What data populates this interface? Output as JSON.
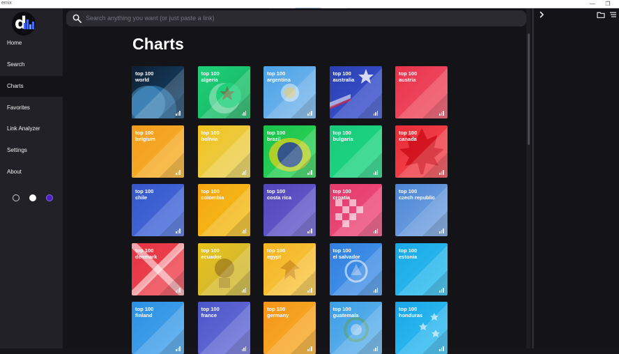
{
  "window": {
    "app_name": "emix",
    "controls": [
      "—",
      "❐"
    ]
  },
  "sidebar": {
    "items": [
      {
        "label": "Home",
        "active": false
      },
      {
        "label": "Search",
        "active": false
      },
      {
        "label": "Charts",
        "active": true
      },
      {
        "label": "Favorites",
        "active": false
      },
      {
        "label": "Link Analyzer",
        "active": false
      },
      {
        "label": "Settings",
        "active": false
      },
      {
        "label": "About",
        "active": false
      }
    ],
    "themes": [
      "dark",
      "light",
      "purple"
    ]
  },
  "search": {
    "placeholder": "Search anything you want (or just paste a link)"
  },
  "main": {
    "title": "Charts"
  },
  "charts": [
    {
      "t1": "top 100",
      "t2": "world",
      "color": "#0d1f33",
      "color2": "#184a73",
      "emblem": "globe"
    },
    {
      "t1": "top 100",
      "t2": "algeria",
      "color": "#1fd07a",
      "color2": "#16b35f",
      "emblem": "crescent"
    },
    {
      "t1": "top 100",
      "t2": "argentina",
      "color": "#4aa2e8",
      "color2": "#7db9ea",
      "emblem": "sun"
    },
    {
      "t1": "top 100",
      "t2": "australia",
      "color": "#2a3fb0",
      "color2": "#3c55d4",
      "emblem": "star"
    },
    {
      "t1": "top 100",
      "t2": "austria",
      "color": "#e8334a",
      "color2": "#f05266",
      "emblem": "none"
    },
    {
      "t1": "top 100",
      "t2": "belgium",
      "color": "#f39b1c",
      "color2": "#f7b52e",
      "emblem": "none"
    },
    {
      "t1": "top 100",
      "t2": "bolivia",
      "color": "#f2c11d",
      "color2": "#e8d35a",
      "emblem": "none"
    },
    {
      "t1": "top 100",
      "t2": "brazil",
      "color": "#19c24a",
      "color2": "#2fd65b",
      "emblem": "orb"
    },
    {
      "t1": "top 100",
      "t2": "bulgaria",
      "color": "#17c97a",
      "color2": "#1fd984",
      "emblem": "none"
    },
    {
      "t1": "top 100",
      "t2": "canada",
      "color": "#ea2b36",
      "color2": "#f24a52",
      "emblem": "leaf"
    },
    {
      "t1": "top 100",
      "t2": "chile",
      "color": "#3456c8",
      "color2": "#4a6fe0",
      "emblem": "none"
    },
    {
      "t1": "top 100",
      "t2": "colombia",
      "color": "#f6a410",
      "color2": "#f2c21a",
      "emblem": "none"
    },
    {
      "t1": "top 100",
      "t2": "costa rica",
      "color": "#5146b8",
      "color2": "#6b5fd0",
      "emblem": "none"
    },
    {
      "t1": "top 100",
      "t2": "croatia",
      "color": "#e23a6a",
      "color2": "#f05080",
      "emblem": "checker"
    },
    {
      "t1": "top 100",
      "t2": "czech republic",
      "color": "#4a86d6",
      "color2": "#7aa6e2",
      "emblem": "none"
    },
    {
      "t1": "top 100",
      "t2": "denmark",
      "color": "#e63341",
      "color2": "#f04a55",
      "emblem": "cross"
    },
    {
      "t1": "top 100",
      "t2": "ecuador",
      "color": "#e8c21a",
      "color2": "#c9b43a",
      "emblem": "shield"
    },
    {
      "t1": "top 100",
      "t2": "egypt",
      "color": "#f5b21f",
      "color2": "#f7cb47",
      "emblem": "eagle"
    },
    {
      "t1": "top 100",
      "t2": "el salvador",
      "color": "#2f7fe0",
      "color2": "#4a97ea",
      "emblem": "seal"
    },
    {
      "t1": "top 100",
      "t2": "estonia",
      "color": "#1aa8e6",
      "color2": "#2ec0f0",
      "emblem": "none"
    },
    {
      "t1": "top 100",
      "t2": "finland",
      "color": "#2b8fe2",
      "color2": "#4aa6ee",
      "emblem": "none"
    },
    {
      "t1": "top 100",
      "t2": "france",
      "color": "#4a56c8",
      "color2": "#6c70d8",
      "emblem": "none"
    },
    {
      "t1": "top 100",
      "t2": "germany",
      "color": "#f5941a",
      "color2": "#f6b02a",
      "emblem": "none"
    },
    {
      "t1": "top 100",
      "t2": "guatemala",
      "color": "#3a9ee6",
      "color2": "#6ab6ec",
      "emblem": "wreath"
    },
    {
      "t1": "top 100",
      "t2": "honduras",
      "color": "#1aa6e8",
      "color2": "#34c0f2",
      "emblem": "stars"
    }
  ]
}
